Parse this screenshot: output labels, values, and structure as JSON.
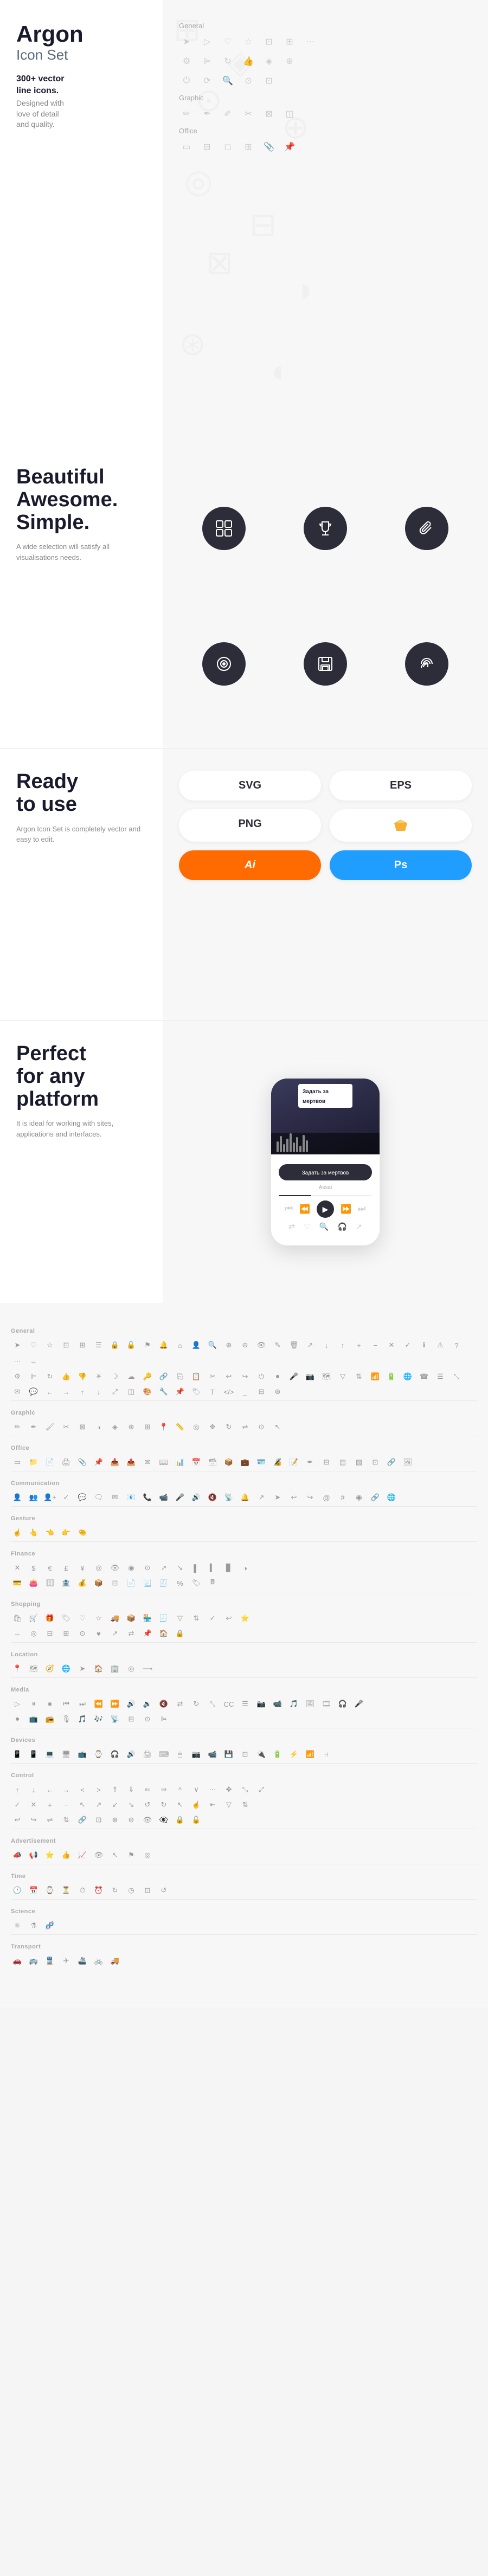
{
  "app": {
    "title": "Argon",
    "subtitle": "Icon Set",
    "icon_count": "300+ vector",
    "icon_count2": "line icons.",
    "designed_line1": "Designed with",
    "designed_line2": "love of detail",
    "designed_line3": "and quality."
  },
  "categories_top": {
    "general_label": "General",
    "graphic_label": "Graphic",
    "office_label": "Office"
  },
  "beautiful": {
    "title_line1": "Beautiful",
    "title_line2": "Awesome.",
    "title_line3": "Simple.",
    "desc": "A wide selection will satisfy all visualisations needs."
  },
  "ready": {
    "title_line1": "Ready",
    "title_line2": "to use",
    "desc": "Argon Icon Set is completely vector and easy to edit.",
    "formats": [
      "SVG",
      "EPS",
      "PNG",
      "Sketch",
      "Ai",
      "Ps"
    ]
  },
  "platform": {
    "title_line1": "Perfect",
    "title_line2": "for any",
    "title_line3": "platform",
    "desc": "It is ideal for working with sites, applications and interfaces.",
    "phone": {
      "song": "Задать за мертвов",
      "artist": "Assai"
    }
  },
  "bottom_categories": [
    "General",
    "Graphic",
    "Office",
    "Communication",
    "Gesture",
    "Finance",
    "Shopping",
    "Location",
    "Media",
    "Devices",
    "Control",
    "Advertisement",
    "Time",
    "Science",
    "Transport"
  ],
  "colors": {
    "dark": "#2d2d3a",
    "accent_orange": "#ff6b00",
    "accent_blue": "#1f9eff",
    "text_dark": "#1a1a2e",
    "text_gray": "#888888",
    "icon_light": "#cccccc",
    "bg_light": "#f7f7f7"
  }
}
